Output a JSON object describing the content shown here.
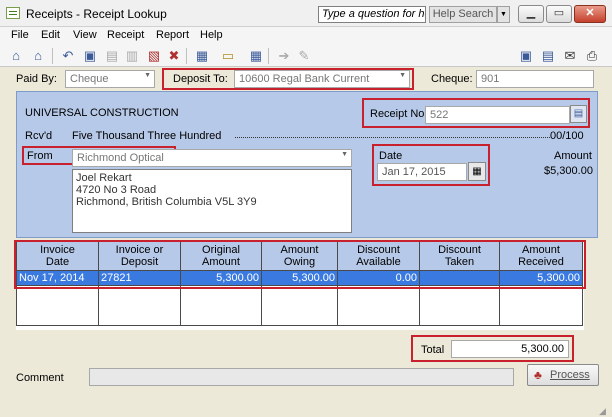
{
  "window": {
    "title": "Receipts - Receipt Lookup",
    "help_placeholder": "Type a question for help",
    "help_search_label": "Help Search",
    "min_glyph": "▁",
    "max_glyph": "▭",
    "close_glyph": "✕"
  },
  "menu": [
    "File",
    "Edit",
    "View",
    "Receipt",
    "Report",
    "Help"
  ],
  "toolbar": {
    "icons": [
      "home-icon",
      "home-alt-icon",
      "undo-icon",
      "receipt-icon",
      "doc-icon",
      "lookup-icon",
      "delete-icon",
      "journal-icon",
      "card-icon",
      "calculator-icon",
      "forward-icon",
      "edit-icon",
      "window-icon",
      "preview-icon",
      "email-icon",
      "print-icon"
    ]
  },
  "header": {
    "paid_by_label": "Paid By:",
    "paid_by_value": "Cheque",
    "deposit_to_label": "Deposit To:",
    "deposit_to_value": "10600 Regal Bank Current",
    "cheque_label": "Cheque:",
    "cheque_value": "901"
  },
  "receipt": {
    "company": "UNIVERSAL CONSTRUCTION",
    "receipt_no_label": "Receipt No.",
    "receipt_no_value": "522",
    "rcvd_label": "Rcv'd",
    "amount_words": "Five Thousand Three Hundred",
    "cents_text": "00/100",
    "from_label": "From",
    "from_value": "Richmond Optical",
    "address": [
      "Joel Rekart",
      "4720 No 3 Road",
      "Richmond, British Columbia V5L 3Y9"
    ],
    "date_label": "Date",
    "date_value": "Jan 17, 2015",
    "amount_label": "Amount",
    "amount_value": "$5,300.00"
  },
  "grid": {
    "headers": [
      [
        "Invoice",
        "Date"
      ],
      [
        "Invoice or",
        "Deposit"
      ],
      [
        "Original",
        "Amount"
      ],
      [
        "Amount",
        "Owing"
      ],
      [
        "Discount",
        "Available"
      ],
      [
        "Discount",
        "Taken"
      ],
      [
        "Amount",
        "Received"
      ]
    ],
    "row": [
      "Nov 17, 2014",
      "27821",
      "5,300.00",
      "5,300.00",
      "0.00",
      "",
      "5,300.00"
    ]
  },
  "footer": {
    "total_label": "Total",
    "total_value": "5,300.00",
    "comment_label": "Comment",
    "process_label": "Process"
  }
}
